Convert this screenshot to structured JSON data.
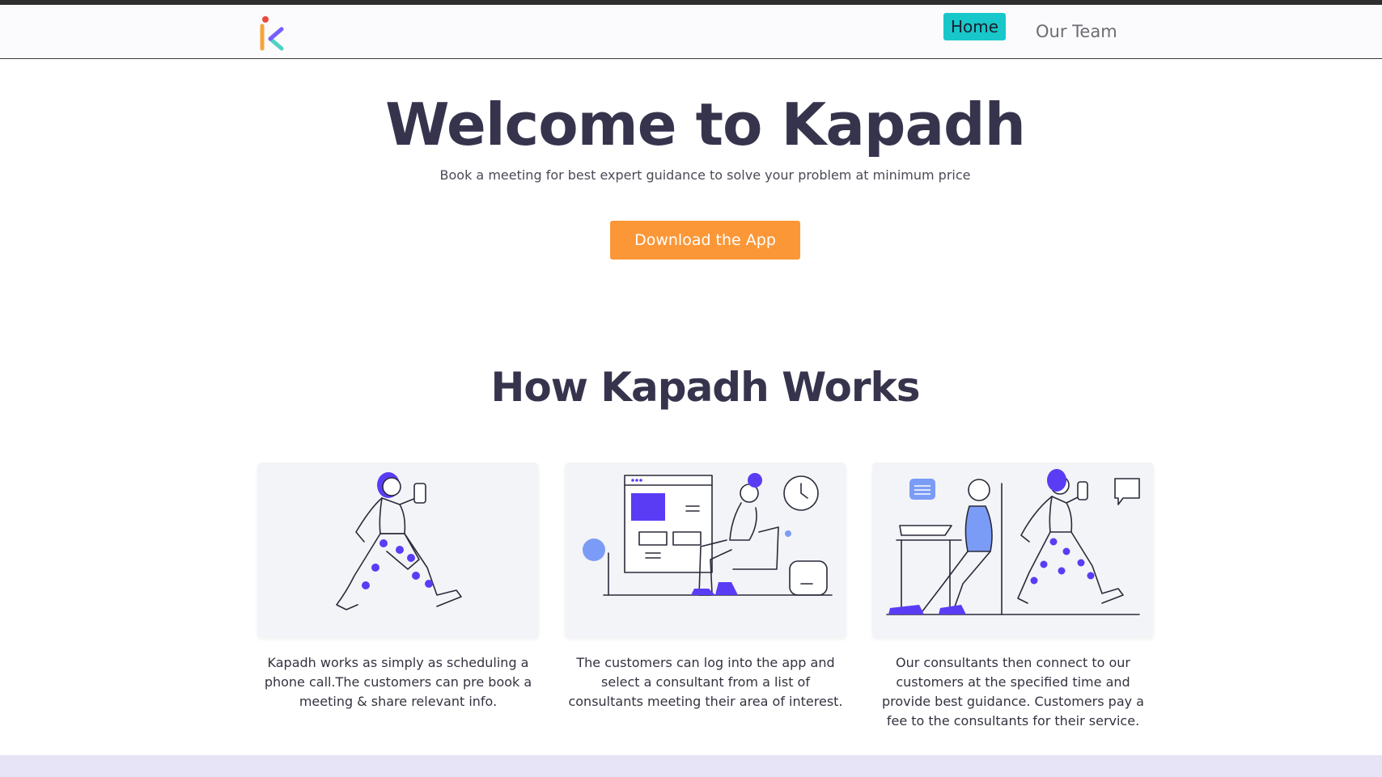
{
  "nav": {
    "logo_icon": "kapadh-logo-icon",
    "home_label": "Home",
    "team_label": "Our Team"
  },
  "hero": {
    "title": "Welcome to Kapadh",
    "subtitle": "Book a meeting for best expert guidance to solve your problem at minimum price",
    "cta_label": "Download the App"
  },
  "how_it_works": {
    "title": "How Kapadh Works",
    "steps": [
      {
        "illustration": "walking-woman-phone-illustration",
        "text": "Kapadh works as simply as scheduling a phone call.The customers can pre book a meeting & share relevant info."
      },
      {
        "illustration": "woman-browsing-app-illustration",
        "text": "The customers can log into the app and select a consultant from a list of consultants meeting their area of interest."
      },
      {
        "illustration": "consultant-connect-illustration",
        "text": "Our consultants then connect to our customers at the specified time and provide best guidance. Customers pay a fee to the consultants for their service."
      }
    ]
  },
  "colors": {
    "accent_teal": "#18c7c9",
    "cta_orange": "#fb9737",
    "heading": "#36344d",
    "illustration_purple": "#5b3cf5",
    "footer_band": "#e6e4f6"
  }
}
